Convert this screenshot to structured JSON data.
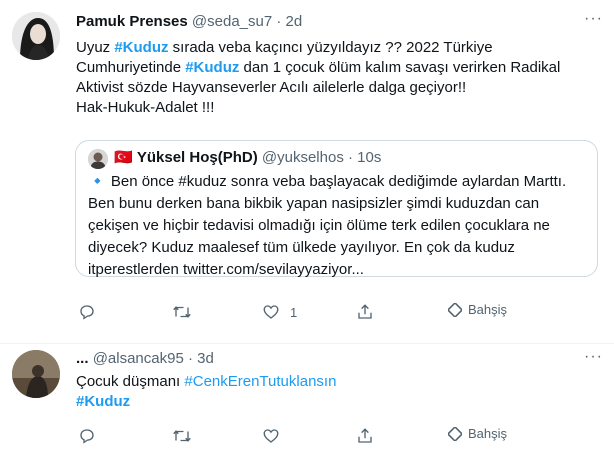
{
  "tweet1": {
    "name": "Pamuk Prenses",
    "handle": "@seda_su7",
    "sep": "·",
    "time": "2d",
    "more": "···",
    "text": {
      "l1a": "Uyuz ",
      "l1tag": "#Kuduz",
      "l1b": " sırada veba kaçıncı yüzyıldayız ?? 2022 Türkiye",
      "l2a": "Cumhuriyetinde ",
      "l2tag": "#Kuduz",
      "l2b": " dan 1 çocuk ölüm kalım savaşı verirken Radikal",
      "l3": "Aktivist sözde Hayvanseverler Acılı ailelerle dalga geçiyor!!",
      "l4": "Hak-Hukuk-Adalet !!!"
    },
    "quote": {
      "flag": "🇹🇷",
      "name": "Yüksel Hoş(PhD)",
      "handle": "@yukselhos",
      "sep": "·",
      "time": "10s",
      "lines": [
        "🔹 Ben önce #kuduz sonra veba başlayacak dediğimde aylardan Marttı.",
        "Ben bunu derken bana bikbik yapan nasipsizler şimdi kuduzdan can",
        "çekişen ve hiçbir tedavisi olmadığı için ölüme terk edilen çocuklara ne",
        "diyecek? Kuduz maalesef tüm ülkede yayılıyor. En çok da kuduz",
        "itperestlerden twitter.com/sevilayyaziyor..."
      ]
    },
    "actions": {
      "like_count": "1",
      "share_label": "Bahşiş"
    }
  },
  "tweet2": {
    "name": "...",
    "handle": "@alsancak95",
    "sep": "·",
    "time": "3d",
    "more": "···",
    "text": {
      "l1a": "Çocuk düşmanı ",
      "l1tag": "#CenkErenTutuklansın",
      "l2tag": "#Kuduz"
    },
    "actions": {
      "share_label": "Bahşiş"
    }
  },
  "colors": {
    "link": "#1d9bf0",
    "muted": "#536471",
    "border": "#cfd9de"
  }
}
